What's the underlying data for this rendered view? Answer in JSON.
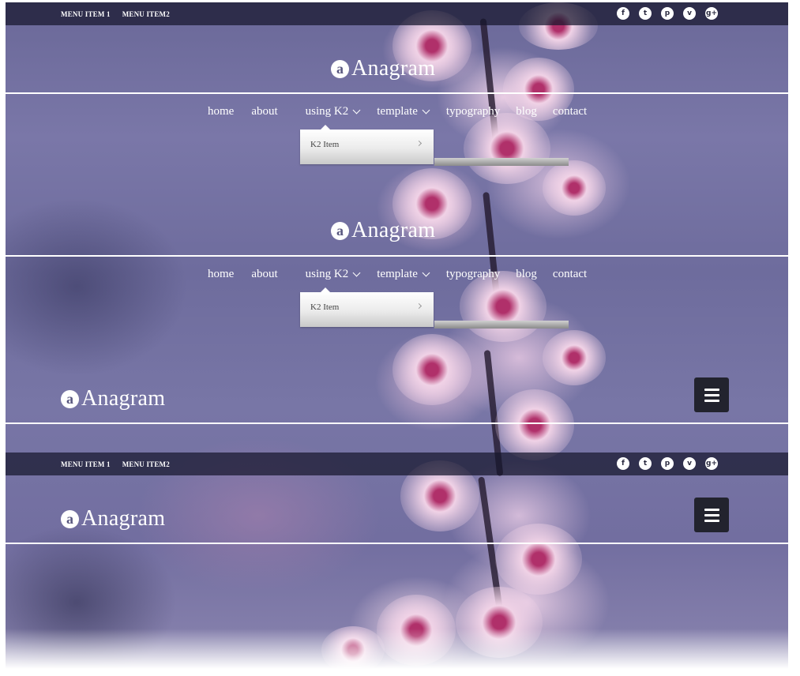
{
  "topbar": {
    "menu": [
      "MENU ITEM 1",
      "MENU ITEM2"
    ],
    "social": [
      {
        "icon": "facebook-icon",
        "glyph": "f"
      },
      {
        "icon": "twitter-icon",
        "glyph": "t"
      },
      {
        "icon": "pinterest-icon",
        "glyph": "p"
      },
      {
        "icon": "vimeo-icon",
        "glyph": "v"
      },
      {
        "icon": "google-plus-icon",
        "glyph": "g+"
      }
    ]
  },
  "logo": {
    "mark": "a",
    "text": "Anagram"
  },
  "nav": {
    "items": [
      "home",
      "about",
      "using K2",
      "template",
      "typography",
      "blog",
      "contact"
    ],
    "dropdown_item": "K2 Item"
  },
  "colors": {
    "topbar": "#16162d",
    "hamburger": "#22232e",
    "text": "#ffffff",
    "rule": "#ffffff"
  }
}
